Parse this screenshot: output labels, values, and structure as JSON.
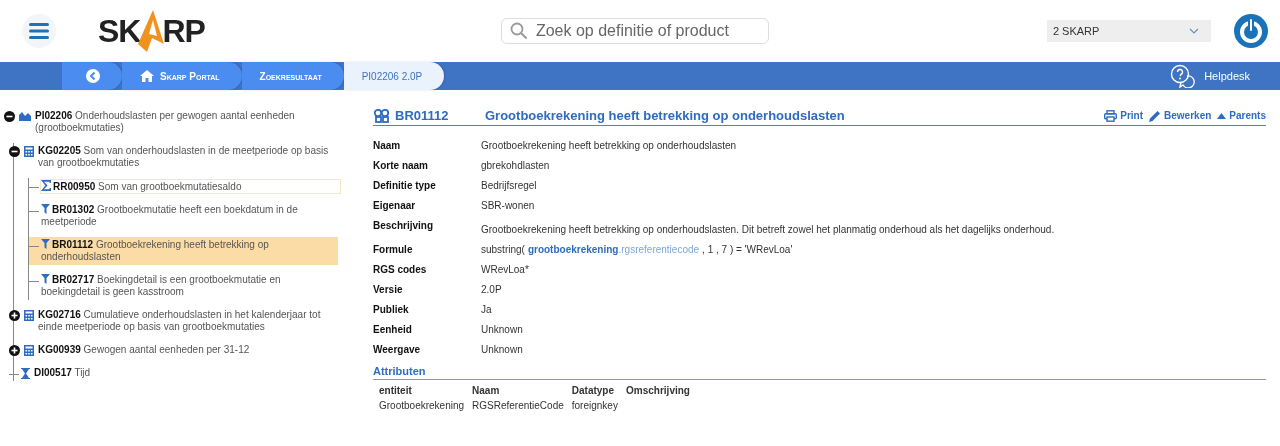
{
  "logo": {
    "left": "SK",
    "right": "RP"
  },
  "search": {
    "placeholder": "Zoek op definitie of product"
  },
  "org_select": {
    "value": "2 SKARP"
  },
  "breadcrumbs": [
    {
      "kind": "back",
      "selected": false
    },
    {
      "kind": "home",
      "label": "Skarp Portal",
      "selected": false
    },
    {
      "kind": "plain",
      "label": "Zoekresultaat",
      "selected": false
    },
    {
      "kind": "plain",
      "label": "PI02206 2.0P",
      "selected": true
    }
  ],
  "helpdesk": "Helpdesk",
  "tree": [
    {
      "kind": "indicator",
      "code": "PI02206",
      "text": "Onderhoudslasten per gewogen aantal eenheden (grootboekmutaties)",
      "expanded": true,
      "selected": false,
      "focused": false,
      "children": [
        {
          "kind": "calc",
          "code": "KG02205",
          "text": "Som van onderhoudslasten in de meetperiode op basis van grootboekmutaties",
          "expanded": true,
          "selected": false,
          "focused": false,
          "children": [
            {
              "kind": "sum",
              "code": "RR00950",
              "text": "Som van grootboekmutatiesaldo",
              "selected": false,
              "focused": true
            },
            {
              "kind": "rule",
              "code": "BR01302",
              "text": "Grootboekmutatie heeft een boekdatum in de meetperiode",
              "selected": false,
              "focused": false
            },
            {
              "kind": "rule",
              "code": "BR01112",
              "text": "Grootboekrekening heeft betrekking op onderhoudslasten",
              "selected": true,
              "focused": false
            },
            {
              "kind": "rule",
              "code": "BR02717",
              "text": "Boekingdetail is een grootboekmutatie en boekingdetail is geen kasstroom",
              "selected": false,
              "focused": false
            }
          ]
        },
        {
          "kind": "calc",
          "code": "KG02716",
          "text": "Cumulatieve onderhoudslasten in het kalenderjaar tot einde meetperiode op basis van grootboekmutaties",
          "expanded": false,
          "selected": false,
          "focused": false
        },
        {
          "kind": "calc",
          "code": "KG00939",
          "text": "Gewogen aantal eenheden per 31-12",
          "expanded": false,
          "selected": false,
          "focused": false
        },
        {
          "kind": "data",
          "code": "DI00517",
          "text": "Tijd",
          "selected": false,
          "focused": false
        }
      ]
    }
  ],
  "detail": {
    "code": "BR01112",
    "title": "Grootboekrekening heeft betrekking op onderhoudslasten",
    "actions": [
      {
        "kind": "print",
        "label": "Print"
      },
      {
        "kind": "edit",
        "label": "Bewerken"
      },
      {
        "kind": "parents",
        "label": "Parents"
      }
    ],
    "fields": [
      {
        "label": "Naam",
        "value": "Grootboekrekening heeft betrekking op onderhoudslasten"
      },
      {
        "label": "Korte naam",
        "value": "gbrekohdlasten"
      },
      {
        "label": "Definitie type",
        "value": "Bedrijfsregel"
      },
      {
        "label": "Eigenaar",
        "value": "SBR-wonen"
      },
      {
        "label": "Beschrijving",
        "value": "Grootboekrekening heeft betrekking op onderhoudslasten. Dit betreft zowel het planmatig onderhoud als het dagelijks onderhoud."
      },
      {
        "label": "Formule",
        "formula": [
          {
            "kind": "plain",
            "text": "substring("
          },
          {
            "kind": "entity",
            "text": "grootboekrekening"
          },
          {
            "kind": "attribute",
            "text": ".rgsreferentiecode"
          },
          {
            "kind": "plain",
            "text": ", 1 , 7 ) = 'WRevLoa'"
          }
        ]
      },
      {
        "label": "RGS codes",
        "value": "WRevLoa*"
      },
      {
        "label": "Versie",
        "value": "2.0P"
      },
      {
        "label": "Publiek",
        "value": "Ja"
      },
      {
        "label": "Eenheid",
        "value": "Unknown"
      },
      {
        "label": "Weergave",
        "value": "Unknown"
      }
    ],
    "attributes": {
      "title": "Attributen",
      "columns": [
        "entiteit",
        "Naam",
        "Datatype",
        "Omschrijving"
      ],
      "rows": [
        [
          "Grootboekrekening",
          "RGSReferentieCode",
          "foreignkey"
        ]
      ]
    }
  }
}
